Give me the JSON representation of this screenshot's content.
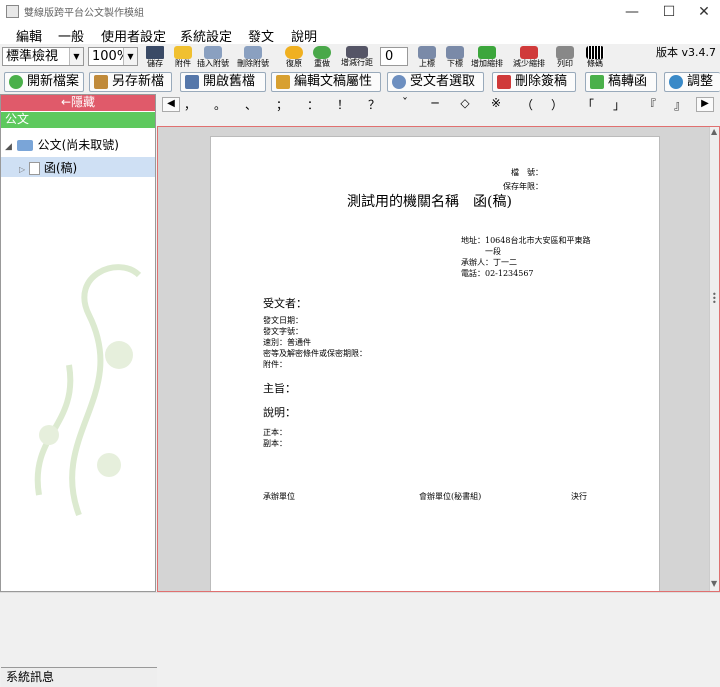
{
  "window": {
    "title": "雙線版跨平台公文製作模組",
    "controls": {
      "minimize": "—",
      "maximize": "☐",
      "close": "✕"
    }
  },
  "menu": [
    "編輯",
    "一般",
    "使用者設定",
    "系統設定",
    "發文",
    "說明"
  ],
  "toolbar": {
    "view_mode": "標準檢視",
    "zoom": "100%",
    "font_step": "0",
    "version": "版本 v3.4.7",
    "buttons": [
      "儲存",
      "附件",
      "插入附號",
      "刪除附號",
      "復原",
      "重做",
      "增減行距",
      "上標",
      "下標",
      "增加縮排",
      "減少縮排",
      "列印",
      "條碼"
    ]
  },
  "actions": [
    "開新檔案",
    "另存新檔",
    "開啟舊檔",
    "編輯文稿屬性",
    "受文者選取",
    "刪除簽稿",
    "稿轉函",
    "調整"
  ],
  "sidebar": {
    "hide_label": "←隱藏",
    "tab": "公文",
    "tree": [
      {
        "label": "公文(尚未取號)"
      },
      {
        "label": "函(稿)"
      }
    ],
    "system_messages": "系統訊息"
  },
  "symbols": [
    "，",
    "。",
    "、",
    "；",
    "：",
    "！",
    "？",
    "ˇ",
    "─",
    "◇",
    "※",
    "（",
    "）",
    "「",
    "」",
    "『",
    "』"
  ],
  "document": {
    "file_no_label": "檔　號：",
    "retention_label": "保存年限：",
    "title": "測試用的機關名稱　函(稿)",
    "address_label": "地址：",
    "address_line1": "10648台北市大安區和平東路",
    "address_line2": "一段",
    "handler": "承辦人：丁一二",
    "phone": "電話：02-1234567",
    "recipient": "受文者：",
    "date_label": "發文日期：",
    "number_label": "發文字號：",
    "speed": "速別：普通件",
    "secrecy": "密等及解密條件或保密期限：",
    "attachment": "附件：",
    "subject": "主旨：",
    "explanation": "說明：",
    "original": "正本：",
    "copy": "副本：",
    "unit": "承辦單位",
    "co_unit": "會辦單位(秘書組)",
    "decision": "決行"
  },
  "colors": {
    "hide_bar": "#e05a6a",
    "doc_tab": "#5ec95e",
    "doc_border": "#e07070"
  }
}
